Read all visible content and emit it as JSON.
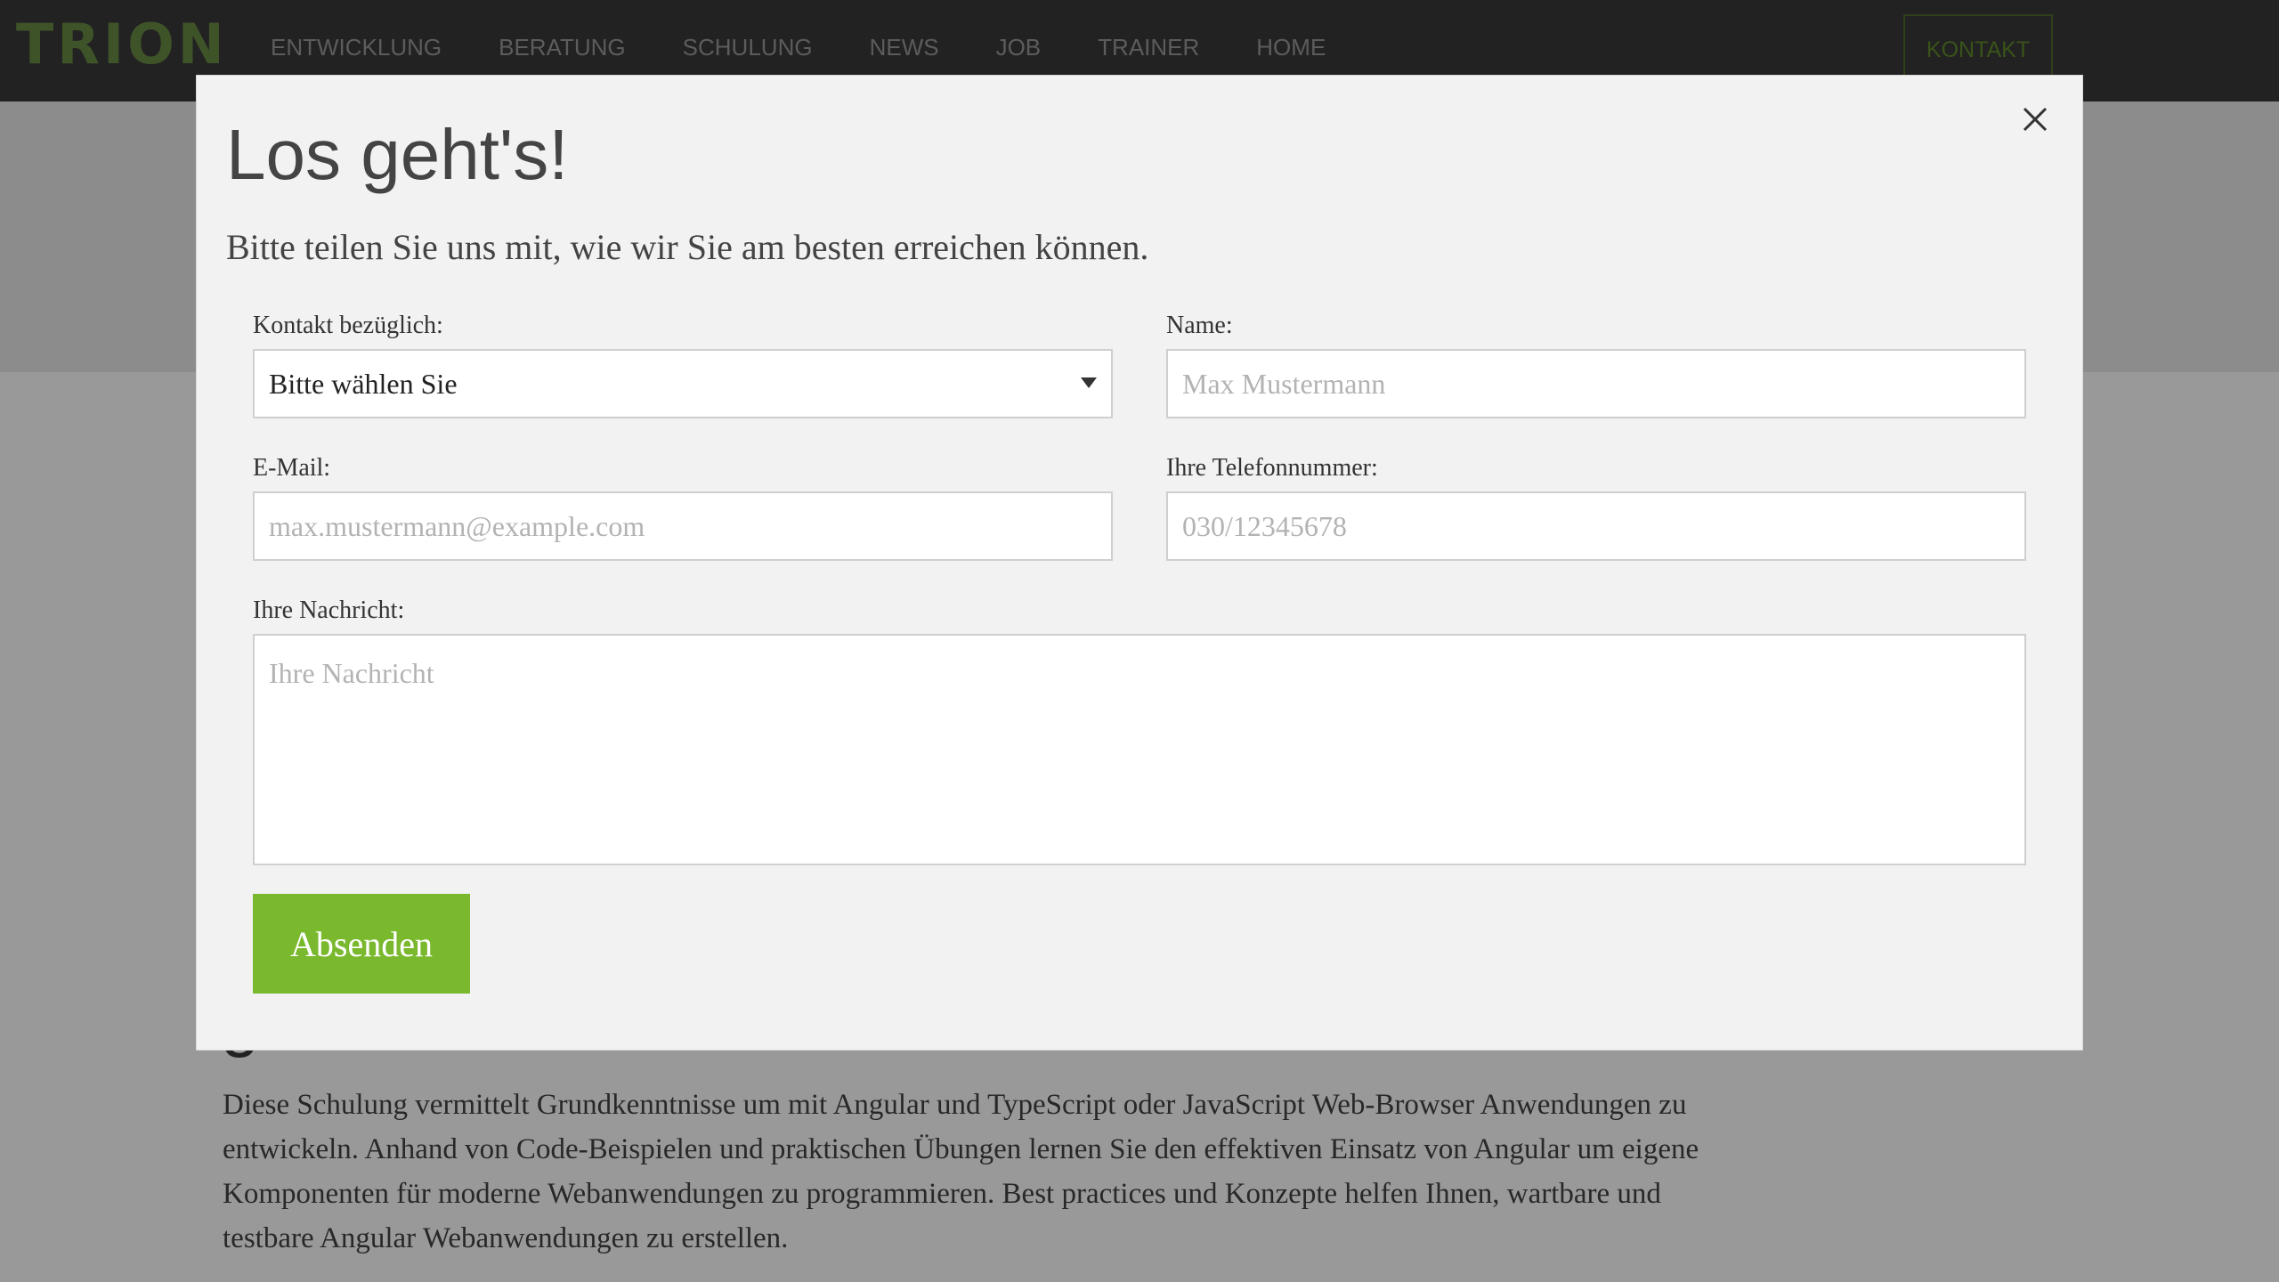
{
  "navbar": {
    "logo_text": "TRION",
    "links": [
      "ENTWICKLUNG",
      "BERATUNG",
      "SCHULUNG",
      "NEWS",
      "JOB",
      "TRAINER",
      "HOME"
    ],
    "contact_label": "KONTAKT"
  },
  "page": {
    "partial_heading": "g",
    "description": "Diese Schulung vermittelt Grundkenntnisse um mit Angular und TypeScript oder JavaScript Web-Browser Anwendungen zu entwickeln. Anhand von Code-Beispielen und praktischen Übungen lernen Sie den effektiven Einsatz von Angular um eigene Komponenten für moderne Webanwendungen zu programmieren. Best practices und Konzepte helfen Ihnen, wartbare und testbare Angular Webanwendungen zu erstellen."
  },
  "modal": {
    "title": "Los geht's!",
    "subtitle": "Bitte teilen Sie uns mit, wie wir Sie am besten erreichen können.",
    "fields": {
      "topic": {
        "label": "Kontakt bezüglich:",
        "selected": "Bitte wählen Sie"
      },
      "name": {
        "label": "Name:",
        "placeholder": "Max Mustermann",
        "value": ""
      },
      "email": {
        "label": "E-Mail:",
        "placeholder": "max.mustermann@example.com",
        "value": ""
      },
      "phone": {
        "label": "Ihre Telefonnummer:",
        "placeholder": "030/12345678",
        "value": ""
      },
      "message": {
        "label": "Ihre Nachricht:",
        "placeholder": "Ihre Nachricht",
        "value": ""
      }
    },
    "submit_label": "Absenden",
    "close_icon": "close-icon"
  },
  "colors": {
    "accent_green": "#7ab92e",
    "navbar_bg": "#3a3a3a",
    "modal_bg": "#f2f2f2"
  }
}
